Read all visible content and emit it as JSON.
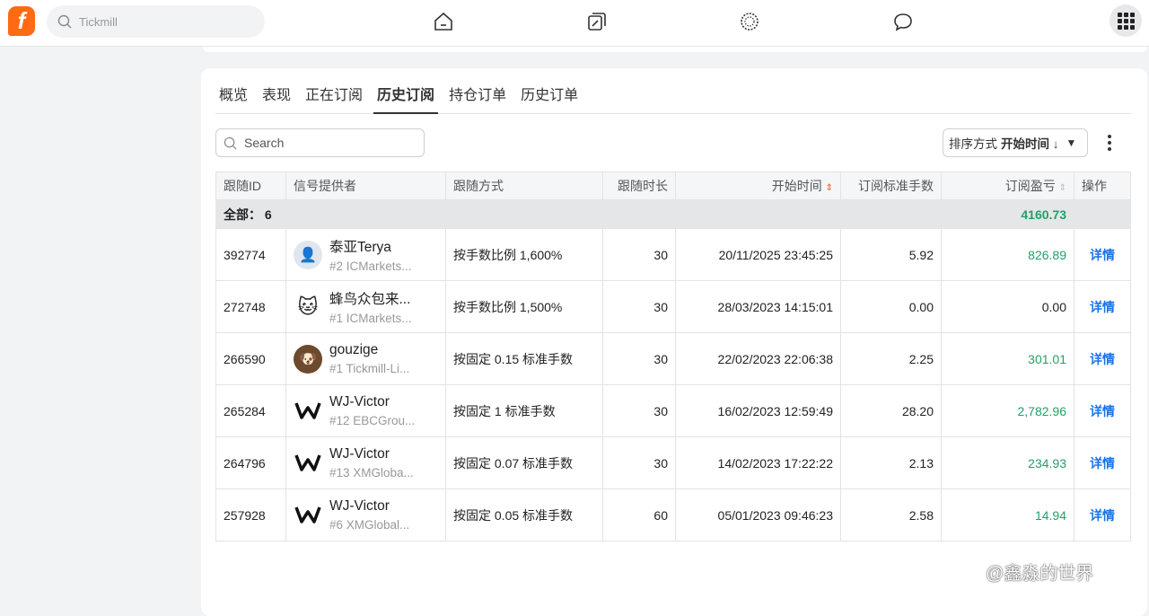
{
  "topbar": {
    "search_placeholder": "Tickmill",
    "logo": "f"
  },
  "tabs": [
    "概览",
    "表现",
    "正在订阅",
    "历史订阅",
    "持仓订单",
    "历史订单"
  ],
  "active_tab": 3,
  "search": {
    "placeholder": "Search"
  },
  "sort": {
    "label": "排序方式",
    "value": "开始时间 ↓"
  },
  "columns": [
    "跟随ID",
    "信号提供者",
    "跟随方式",
    "跟随时长",
    "开始时间",
    "订阅标准手数",
    "订阅盈亏",
    "操作"
  ],
  "total": {
    "label": "全部： 6",
    "pnl": "4160.73"
  },
  "rows": [
    {
      "id": "392774",
      "name": "泰亚Terya",
      "sub": "#2 ICMarkets...",
      "mode": "按手数比例 1,600%",
      "days": "30",
      "start": "20/11/2025 23:45:25",
      "lots": "5.92",
      "pnl": "826.89",
      "action": "详情"
    },
    {
      "id": "272748",
      "name": "蜂鸟众包来...",
      "sub": "#1 ICMarkets...",
      "mode": "按手数比例 1,500%",
      "days": "30",
      "start": "28/03/2023 14:15:01",
      "lots": "0.00",
      "pnl": "0.00",
      "action": "详情"
    },
    {
      "id": "266590",
      "name": "gouzige",
      "sub": "#1 Tickmill-Li...",
      "mode": "按固定 0.15 标准手数",
      "days": "30",
      "start": "22/02/2023 22:06:38",
      "lots": "2.25",
      "pnl": "301.01",
      "action": "详情"
    },
    {
      "id": "265284",
      "name": "WJ-Victor",
      "sub": "#12 EBCGrou...",
      "mode": "按固定 1 标准手数",
      "days": "30",
      "start": "16/02/2023 12:59:49",
      "lots": "28.20",
      "pnl": "2,782.96",
      "action": "详情"
    },
    {
      "id": "264796",
      "name": "WJ-Victor",
      "sub": "#13 XMGloba...",
      "mode": "按固定 0.07 标准手数",
      "days": "30",
      "start": "14/02/2023 17:22:22",
      "lots": "2.13",
      "pnl": "234.93",
      "action": "详情"
    },
    {
      "id": "257928",
      "name": "WJ-Victor",
      "sub": "#6 XMGlobal...",
      "mode": "按固定 0.05 标准手数",
      "days": "60",
      "start": "05/01/2023 09:46:23",
      "lots": "2.58",
      "pnl": "14.94",
      "action": "详情"
    }
  ],
  "watermark": "@鑫淼的世界",
  "colors": {
    "brand": "#ff6a13",
    "profit": "#23a067",
    "link": "#1a73e8"
  }
}
